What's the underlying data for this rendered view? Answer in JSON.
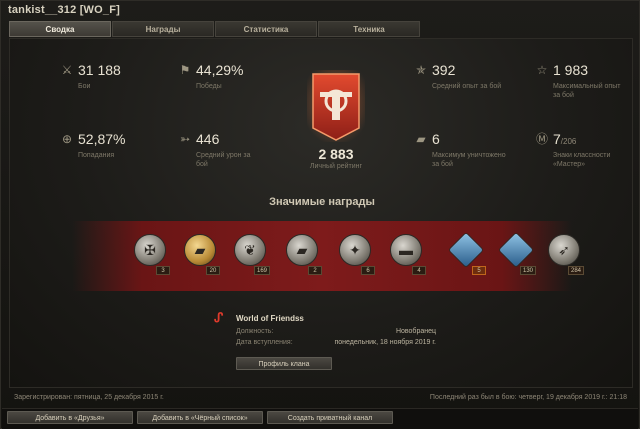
{
  "window": {
    "title": "tankist__312 [WO_F]"
  },
  "tabs": [
    {
      "label": "Сводка",
      "active": true
    },
    {
      "label": "Награды",
      "active": false
    },
    {
      "label": "Статистика",
      "active": false
    },
    {
      "label": "Техника",
      "active": false
    }
  ],
  "stats": {
    "battles": {
      "value": "31 188",
      "label": "Бои",
      "icon": "crossed-swords-icon"
    },
    "victories": {
      "value": "44,29%",
      "label": "Победы",
      "icon": "flag-icon"
    },
    "avg_xp": {
      "value": "392",
      "label": "Средний опыт за бой",
      "icon": "star-wings-icon"
    },
    "max_xp": {
      "value": "1 983",
      "label": "Максимальный опыт за бой",
      "icon": "star-icon"
    },
    "hits": {
      "value": "52,87%",
      "label": "Попадания",
      "icon": "crosshair-icon"
    },
    "avg_damage": {
      "value": "446",
      "label": "Средний урон за бой",
      "icon": "shell-icon"
    },
    "max_destroyed": {
      "value": "6",
      "label": "Максимум уничтожено за бой",
      "icon": "tank-icon"
    },
    "mastery": {
      "value": "7",
      "total": "/206",
      "label": "Знаки классности «Мастер»",
      "icon": "mastery-badge-icon"
    }
  },
  "rating": {
    "value": "2 883",
    "label": "Личный рейтинг",
    "accent": "#c0392b"
  },
  "awards": {
    "title": "Значимые награды",
    "items": [
      {
        "name": "medal-1",
        "count": "3",
        "highlight": false,
        "style": "silver"
      },
      {
        "name": "medal-2",
        "count": "20",
        "highlight": false,
        "style": "gold"
      },
      {
        "name": "medal-3",
        "count": "169",
        "highlight": false,
        "style": "silver"
      },
      {
        "name": "medal-4",
        "count": "2",
        "highlight": false,
        "style": "silver"
      },
      {
        "name": "medal-5",
        "count": "6",
        "highlight": false,
        "style": "silver"
      },
      {
        "name": "medal-6",
        "count": "4",
        "highlight": false,
        "style": "silver"
      },
      {
        "name": "medal-7",
        "count": "5",
        "highlight": true,
        "style": "blue"
      },
      {
        "name": "medal-8",
        "count": "130",
        "highlight": false,
        "style": "blue"
      },
      {
        "name": "medal-9",
        "count": "284",
        "highlight": false,
        "style": "silver"
      }
    ]
  },
  "clan": {
    "name": "World of Friendss",
    "position_label": "Должность:",
    "position_value": "Новобранец",
    "joined_label": "Дата вступления:",
    "joined_value": "понедельник, 18 ноября 2019 г.",
    "profile_button": "Профиль клана",
    "logo_color": "#e03a2c"
  },
  "footer": {
    "registered": "Зарегистрирован: пятница, 25 декабря 2015 г.",
    "last_battle": "Последний раз был в бою: четверг, 19 декабря 2019 г.: 21:18"
  },
  "buttons": {
    "add_friend": "Добавить в «Друзья»",
    "add_blacklist": "Добавить в «Чёрный список»",
    "private_channel": "Создать приватный канал"
  }
}
